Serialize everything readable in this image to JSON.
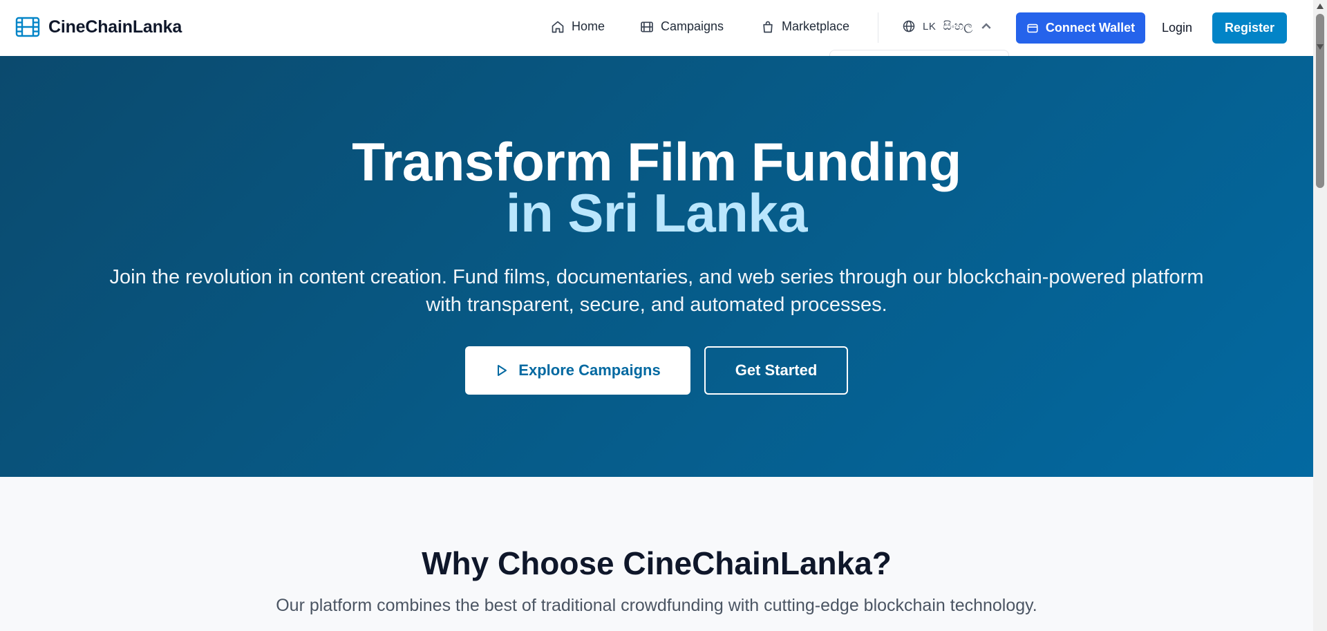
{
  "brand": {
    "name": "CineChainLanka",
    "icon": "film-icon"
  },
  "nav": {
    "home": {
      "label": "Home",
      "icon": "home-icon"
    },
    "campaigns": {
      "label": "Campaigns",
      "icon": "film-strip-icon"
    },
    "marketplace": {
      "label": "Marketplace",
      "icon": "shopping-bag-icon"
    }
  },
  "language": {
    "code": "LK",
    "name": "සිංහල",
    "icon": "globe-icon"
  },
  "header_actions": {
    "connect_wallet": "Connect Wallet",
    "login": "Login",
    "register": "Register"
  },
  "hero": {
    "title_line1": "Transform Film Funding",
    "title_line2": "in Sri Lanka",
    "subtitle_line1": "Join the revolution in content creation. Fund films, documentaries, and web series through our blockchain-powered platform",
    "subtitle_line2": "with transparent, secure, and automated processes.",
    "explore_label": "Explore Campaigns",
    "get_started_label": "Get Started"
  },
  "features": {
    "title": "Why Choose CineChainLanka?",
    "subtitle": "Our platform combines the best of traditional crowdfunding with cutting-edge blockchain technology."
  },
  "colors": {
    "primary_blue": "#2563eb",
    "register_blue": "#0284c7",
    "hero_dark": "#0b4a6e",
    "hero_light": "#0369a1",
    "accent_light": "#bae6fd"
  }
}
